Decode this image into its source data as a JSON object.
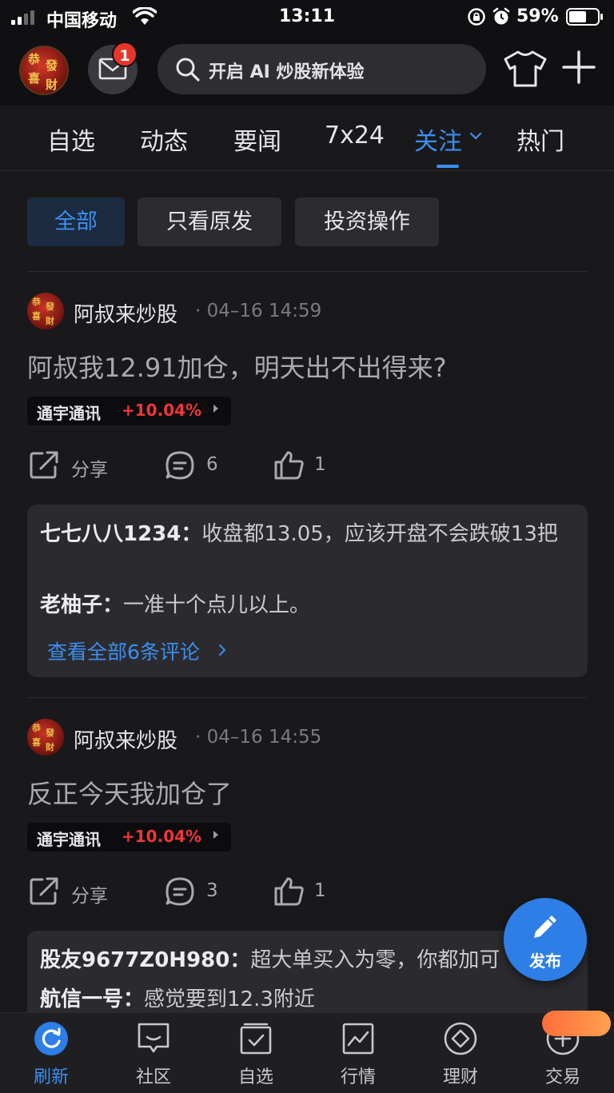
{
  "status_bar": {
    "carrier": "中国移动",
    "time": "13:11",
    "battery": "59%"
  },
  "header": {
    "mail_badge": "1",
    "search_placeholder": "开启 AI 炒股新体验"
  },
  "tabs": [
    {
      "label": "自选"
    },
    {
      "label": "动态"
    },
    {
      "label": "要闻"
    },
    {
      "label": "7x24"
    },
    {
      "label": "关注"
    },
    {
      "label": "热门"
    }
  ],
  "filters": [
    {
      "label": "全部"
    },
    {
      "label": "只看原发"
    },
    {
      "label": "投资操作"
    }
  ],
  "posts": [
    {
      "author": "阿叔来炒股",
      "time": "· 04–16 14:59",
      "text": "阿叔我12.91加仓，明天出不出得来?",
      "stock": {
        "name": "通宇通讯",
        "change": "+10.04%"
      },
      "share_label": "分享",
      "comment_count": "6",
      "like_count": "1",
      "comments": [
        {
          "user": "七七八八1234：",
          "text": "收盘都13.05，应该开盘不会跌破13把"
        },
        {
          "user": "老柚子：",
          "text": "一准十个点儿以上。"
        }
      ],
      "more_label": "查看全部6条评论"
    },
    {
      "author": "阿叔来炒股",
      "time": "· 04–16 14:55",
      "text": "反正今天我加仓了",
      "stock": {
        "name": "通宇通讯",
        "change": "+10.04%"
      },
      "share_label": "分享",
      "comment_count": "3",
      "like_count": "1",
      "comments": [
        {
          "user": "股友9677Z0H980：",
          "text": "超大单买入为零，你都加可"
        },
        {
          "user": "航信一号：",
          "text": "感觉要到12.3附近"
        }
      ]
    }
  ],
  "fab_label": "发布",
  "bottom_nav": [
    {
      "label": "刷新"
    },
    {
      "label": "社区"
    },
    {
      "label": "自选"
    },
    {
      "label": "行情"
    },
    {
      "label": "理财"
    },
    {
      "label": "交易"
    }
  ],
  "colors": {
    "accent": "#3b8ff0",
    "up_red": "#f0363a",
    "background": "#19191b"
  }
}
